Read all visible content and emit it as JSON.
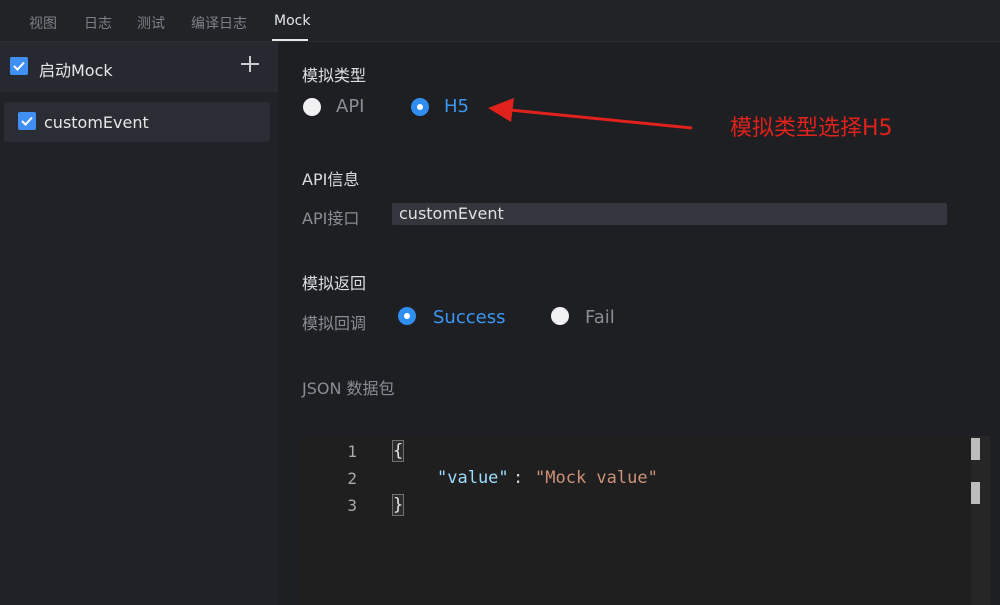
{
  "tabs": [
    "视图",
    "日志",
    "测试",
    "编译日志",
    "Mock"
  ],
  "sidebar": {
    "title": "启动Mock",
    "items": [
      {
        "label": "customEvent"
      }
    ]
  },
  "mock_type": {
    "title": "模拟类型",
    "options": [
      "API",
      "H5"
    ],
    "selected": "H5"
  },
  "api_info": {
    "title": "API信息",
    "endpoint_label": "API接口",
    "endpoint_value": "customEvent"
  },
  "mock_return": {
    "title": "模拟返回",
    "callback_label": "模拟回调",
    "options": [
      "Success",
      "Fail"
    ],
    "selected": "Success"
  },
  "json_package": {
    "title": "JSON 数据包",
    "line_numbers": [
      "1",
      "2",
      "3"
    ],
    "lines": {
      "open": "{",
      "key": "\"value\"",
      "colon": ":",
      "value": "\"Mock value\"",
      "close": "}"
    }
  },
  "annotation": {
    "text": "模拟类型选择H5",
    "color": "#e0211c"
  },
  "colors": {
    "accent": "#2f8ef0",
    "background": "#1d1f22"
  }
}
